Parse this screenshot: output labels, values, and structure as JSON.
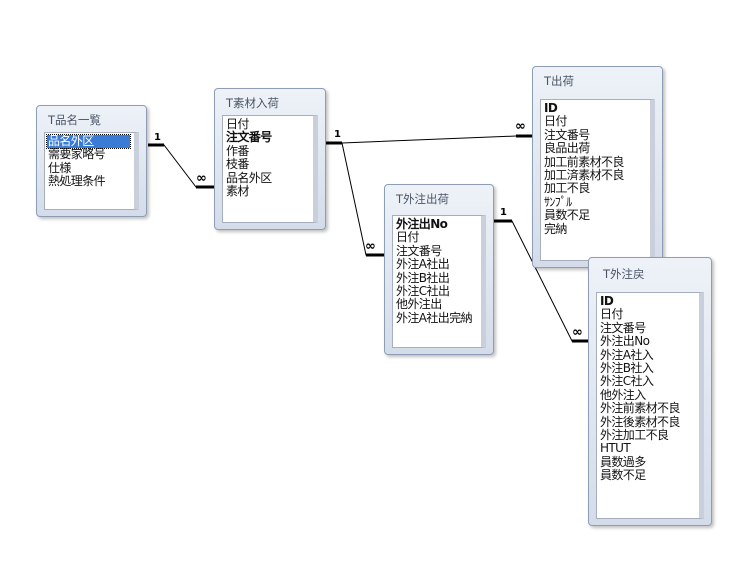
{
  "tables": [
    {
      "id": "hinmei",
      "title": "T品名一覧",
      "fields": [
        {
          "name": "品名外区",
          "pk": true,
          "selected": true
        },
        {
          "name": "需要家略号",
          "pk": false
        },
        {
          "name": "仕様",
          "pk": false
        },
        {
          "name": "熱処理条件",
          "pk": false
        }
      ]
    },
    {
      "id": "sozai",
      "title": "T素材入荷",
      "fields": [
        {
          "name": "日付",
          "pk": false
        },
        {
          "name": "注文番号",
          "pk": true
        },
        {
          "name": "作番",
          "pk": false
        },
        {
          "name": "枝番",
          "pk": false
        },
        {
          "name": "品名外区",
          "pk": false
        },
        {
          "name": "素材",
          "pk": false
        }
      ]
    },
    {
      "id": "shukka",
      "title": "T出荷",
      "fields": [
        {
          "name": "ID",
          "pk": true
        },
        {
          "name": "日付",
          "pk": false
        },
        {
          "name": "注文番号",
          "pk": false
        },
        {
          "name": "良品出荷",
          "pk": false
        },
        {
          "name": "加工前素材不良",
          "pk": false
        },
        {
          "name": "加工済素材不良",
          "pk": false
        },
        {
          "name": "加工不良",
          "pk": false
        },
        {
          "name": "ｻﾝﾌﾟﾙ",
          "pk": false
        },
        {
          "name": "員数不足",
          "pk": false
        },
        {
          "name": "完納",
          "pk": false
        }
      ]
    },
    {
      "id": "gaichu_shukka",
      "title": "T外注出荷",
      "fields": [
        {
          "name": "外注出No",
          "pk": true
        },
        {
          "name": "日付",
          "pk": false
        },
        {
          "name": "注文番号",
          "pk": false
        },
        {
          "name": "外注A社出",
          "pk": false
        },
        {
          "name": "外注B社出",
          "pk": false
        },
        {
          "name": "外注C社出",
          "pk": false
        },
        {
          "name": "他外注出",
          "pk": false
        },
        {
          "name": "外注A社出完納",
          "pk": false
        }
      ]
    },
    {
      "id": "gaichu_modori",
      "title": "T外注戻",
      "fields": [
        {
          "name": "ID",
          "pk": true
        },
        {
          "name": "日付",
          "pk": false
        },
        {
          "name": "注文番号",
          "pk": false
        },
        {
          "name": "外注出No",
          "pk": false
        },
        {
          "name": "外注A社入",
          "pk": false
        },
        {
          "name": "外注B社入",
          "pk": false
        },
        {
          "name": "外注C社入",
          "pk": false
        },
        {
          "name": "他外注入",
          "pk": false
        },
        {
          "name": "外注前素材不良",
          "pk": false
        },
        {
          "name": "外注後素材不良",
          "pk": false
        },
        {
          "name": "外注加工不良",
          "pk": false
        },
        {
          "name": "HTUT",
          "pk": false
        },
        {
          "name": "員数過多",
          "pk": false
        },
        {
          "name": "員数不足",
          "pk": false
        }
      ]
    }
  ],
  "relationships": [
    {
      "from": "hinmei",
      "to": "sozai",
      "one_label": "1",
      "many_label": "∞"
    },
    {
      "from": "sozai",
      "to": "shukka",
      "one_label": "1",
      "many_label": "∞"
    },
    {
      "from": "sozai",
      "to": "gaichu_shukka",
      "one_label": "1",
      "many_label": "∞"
    },
    {
      "from": "gaichu_shukka",
      "to": "gaichu_modori",
      "one_label": "1",
      "many_label": "∞"
    }
  ]
}
